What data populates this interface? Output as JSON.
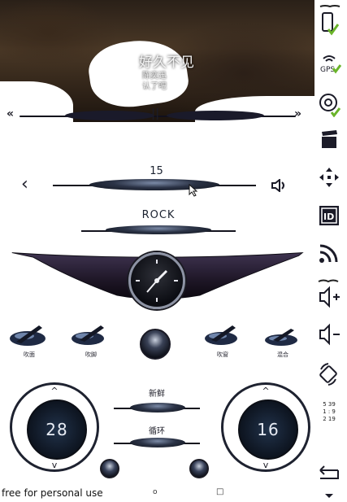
{
  "now_playing": {
    "title": "好久不见",
    "artist": "陈奕迅",
    "album": "认了吧"
  },
  "transport": {
    "prev": "«",
    "pause": "||",
    "next": "»"
  },
  "radio": {
    "frequency": "15",
    "genre": "ROCK"
  },
  "modes": [
    {
      "label": "吹面"
    },
    {
      "label": "吹脚"
    },
    {
      "label": "吹窗"
    },
    {
      "label": "混合"
    }
  ],
  "climate": {
    "left_temp": "28",
    "right_temp": "16",
    "label_top": "新鲜",
    "label_bottom": "循环",
    "up": "^",
    "down": "v"
  },
  "sidebar": {
    "info_lines": [
      "5  39",
      "1 : 9",
      "2  19"
    ]
  },
  "footer": {
    "watermark": "free for personal use",
    "mark_o": "o",
    "mark_sq": "□"
  },
  "colors": {
    "dark": "#1b1b28",
    "accent_green": "#6ab42a",
    "disc": "#21324a"
  }
}
